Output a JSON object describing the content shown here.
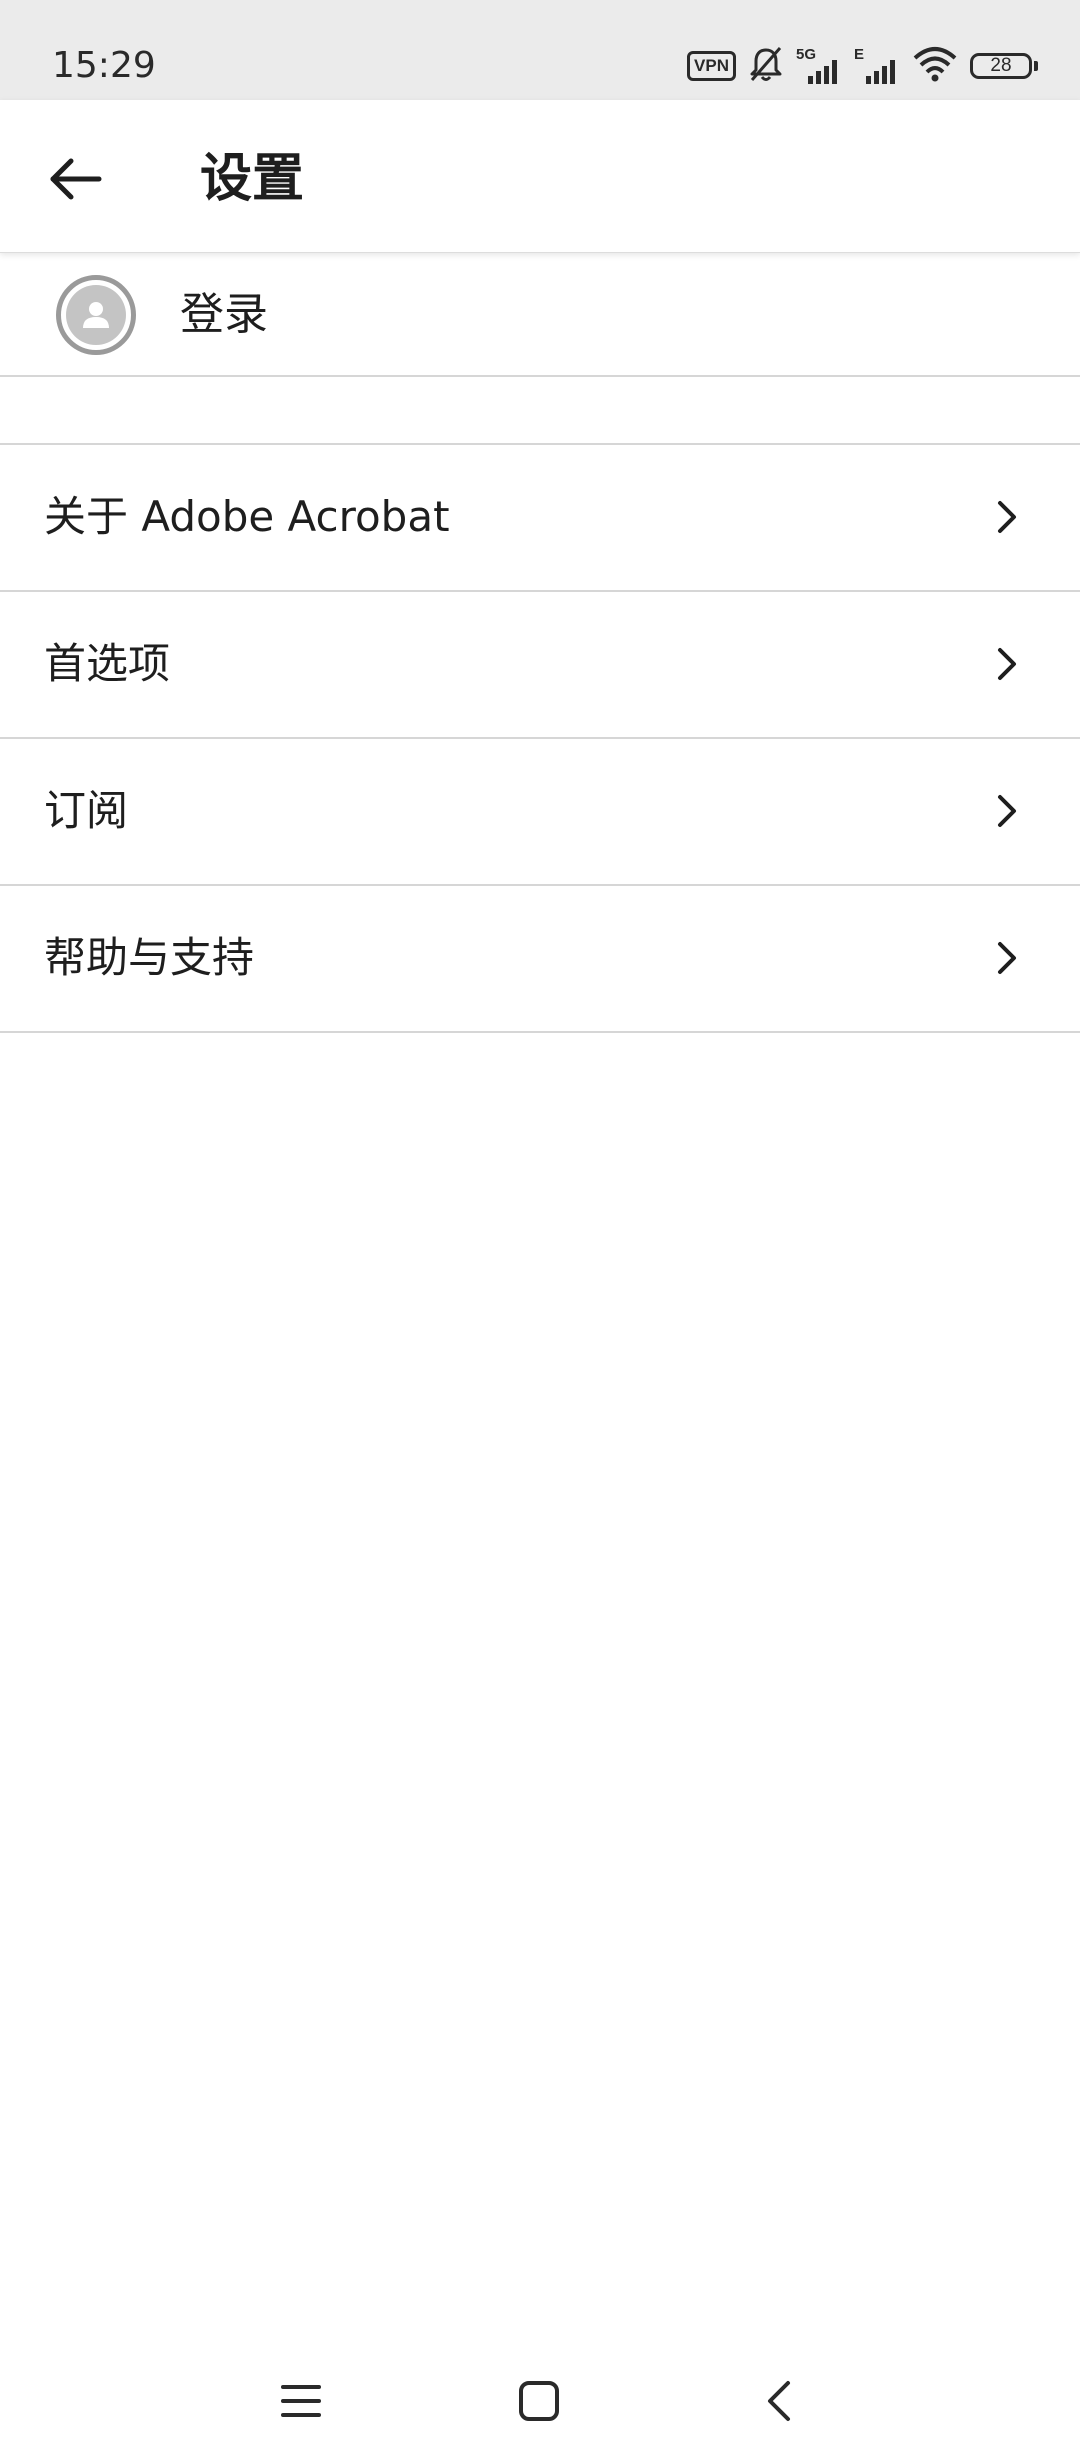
{
  "status_bar": {
    "time": "15:29",
    "vpn_label": "VPN",
    "sim1_label": "5G",
    "sim2_label": "E",
    "battery_level": "28",
    "icons": [
      "vpn-icon",
      "mute-icon",
      "signal-icon",
      "signal-icon",
      "wifi-icon",
      "battery-icon"
    ]
  },
  "toolbar": {
    "back_icon": "arrow-left-icon",
    "title": "设置"
  },
  "account": {
    "avatar_icon": "user-avatar-icon",
    "sign_in_label": "登录"
  },
  "settings": {
    "items": [
      {
        "label": "关于 Adobe Acrobat",
        "icon": "chevron-right-icon"
      },
      {
        "label": "首选项",
        "icon": "chevron-right-icon"
      },
      {
        "label": "订阅",
        "icon": "chevron-right-icon"
      },
      {
        "label": "帮助与支持",
        "icon": "chevron-right-icon"
      }
    ]
  },
  "nav_bar": {
    "icons": [
      "menu-icon",
      "home-icon",
      "back-icon"
    ]
  },
  "colors": {
    "status_bar_bg": "#ebebeb",
    "text": "#1e1e1e",
    "divider": "#d6d6d6",
    "avatar_ring": "#9a9a9a"
  }
}
